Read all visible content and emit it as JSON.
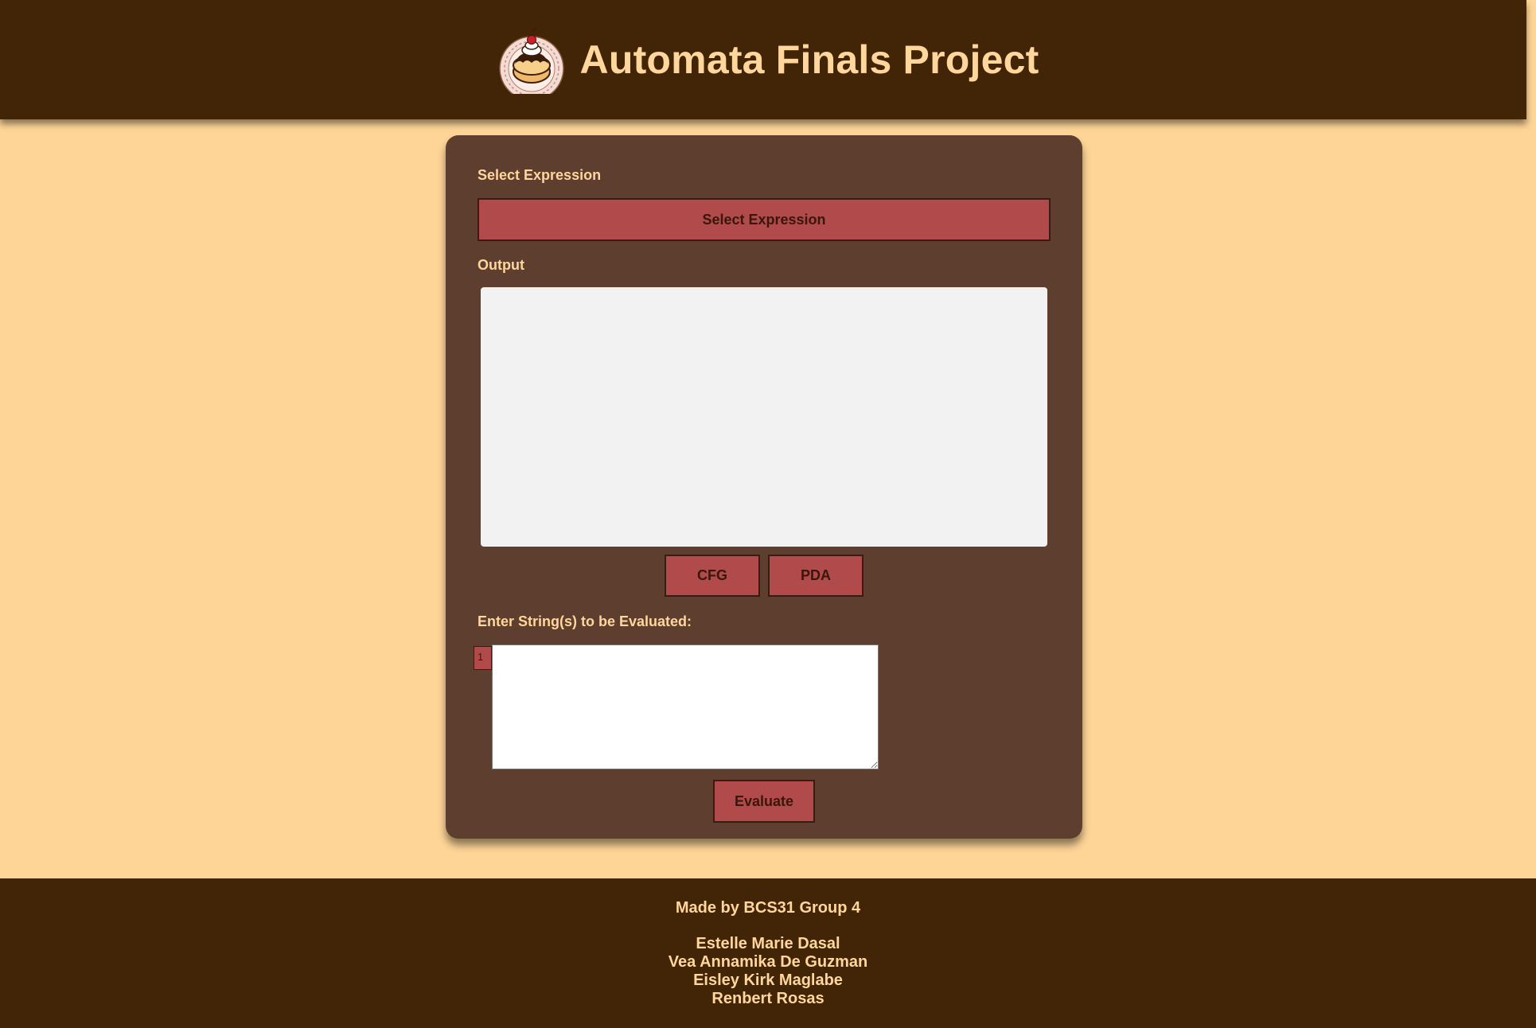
{
  "header": {
    "title": "Automata Finals Project",
    "logo_icon": "cake-icon"
  },
  "form": {
    "select_label": "Select Expression",
    "select_button_label": "Select Expression",
    "output_label": "Output",
    "output_value": "",
    "cfg_label": "CFG",
    "pda_label": "PDA",
    "strings_label": "Enter String(s) to be Evaluated:",
    "line_number": "1",
    "strings_value": "",
    "evaluate_label": "Evaluate"
  },
  "footer": {
    "credit": "Made by BCS31 Group 4",
    "members": [
      "Estelle Marie Dasal",
      "Vea Annamika De Guzman",
      "Eisley Kirk Maglabe",
      "Renbert Rosas"
    ]
  },
  "colors": {
    "page_background": "#fed597",
    "header_background": "#422406",
    "card_background": "#5d3e2f",
    "accent_text": "#ffd69b",
    "button_background": "#b04a4b",
    "button_text": "#3a160c",
    "output_background": "#f2f2f2"
  }
}
